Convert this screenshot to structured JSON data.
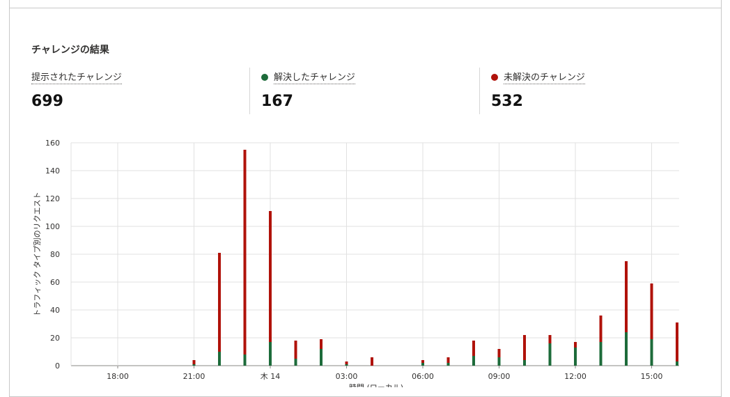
{
  "summary": {
    "title": "チャレンジの結果",
    "presented": {
      "label": "提示されたチャレンジ",
      "value": "699"
    },
    "solved": {
      "label": "解決したチャレンジ",
      "value": "167",
      "color": "#1d6b3a"
    },
    "unsolved": {
      "label": "未解決のチャレンジ",
      "value": "532",
      "color": "#b0120a"
    }
  },
  "chart_data": {
    "type": "bar",
    "stacked": true,
    "ylabel": "トラフィック タイプ別のリクエスト",
    "xlabel": "時間 (ローカル)",
    "ylim": [
      0,
      160
    ],
    "yticks": [
      0,
      20,
      40,
      60,
      80,
      100,
      120,
      140,
      160
    ],
    "xtick_labels": [
      "18:00",
      "21:00",
      "木 14",
      "03:00",
      "06:00",
      "09:00",
      "12:00",
      "15:00"
    ],
    "grid": true,
    "categories": [
      "21:00",
      "22:00",
      "23:00",
      "00:00",
      "01:00",
      "02:00",
      "03:00",
      "04:00",
      "06:00",
      "07:00",
      "08:00",
      "09:00",
      "10:00",
      "11:00",
      "12:00",
      "13:00",
      "14:00",
      "15:00",
      "16:00"
    ],
    "series": [
      {
        "color": "#1d6b3a",
        "values": [
          1,
          10,
          8,
          17,
          5,
          12,
          1,
          0,
          2,
          2,
          7,
          6,
          4,
          16,
          13,
          17,
          24,
          19,
          3
        ]
      },
      {
        "color": "#b0120a",
        "values": [
          3,
          71,
          147,
          94,
          13,
          7,
          2,
          6,
          2,
          4,
          11,
          6,
          18,
          6,
          4,
          19,
          51,
          40,
          28
        ]
      }
    ]
  }
}
